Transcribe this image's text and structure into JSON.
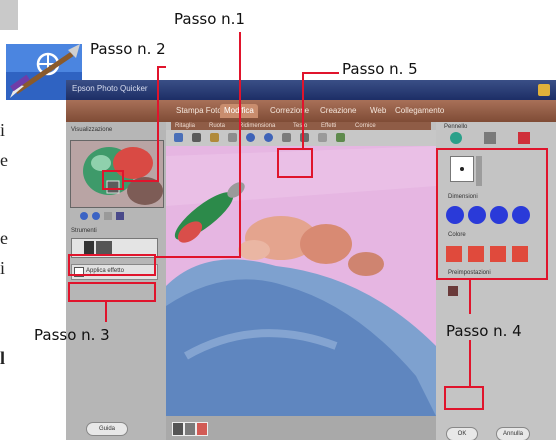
{
  "annotations": {
    "step1": "Passo n.1",
    "step2": "Passo n. 2",
    "step3": "Passo n. 3",
    "step4": "Passo n. 4",
    "step5": "Passo n. 5"
  },
  "background_text": {
    "line1": "i",
    "line2": "e",
    "line3": "e",
    "line4": "i",
    "line5": "l"
  },
  "app": {
    "title": "Epson Photo Quicker",
    "tabs": [
      "Stampa Foto",
      "Modifica",
      "Correzione",
      "Creazione",
      "Web",
      "Collegamento"
    ],
    "active_tab": "Modifica",
    "subtabs": [
      "Ritaglia",
      "Ruota",
      "Ridimensiona",
      "Testo",
      "Effetti",
      "Cornice"
    ],
    "left_panel": {
      "preview_label": "Visualizzazione",
      "thumb_label": "Strumenti",
      "option_label": "Applica effetto"
    },
    "right_panel": {
      "header": "Pennello",
      "size_label": "Dimensioni",
      "color_label": "Colore",
      "preset_label": "Preimpostazioni"
    },
    "buttons": {
      "help": "Guida",
      "ok": "OK",
      "cancel": "Annulla"
    }
  },
  "colors": {
    "annotation": "#e0142c",
    "canvas_bg": "#e6b6e2",
    "title_bar": "#1d2e66"
  }
}
